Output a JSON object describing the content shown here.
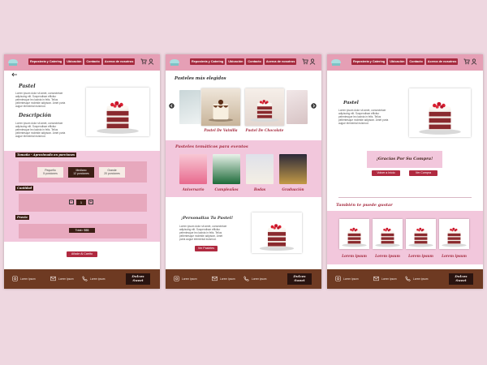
{
  "nav": {
    "links": [
      "Repostería y Catering",
      "Ubicación",
      "Contacto",
      "Acerca de nosotros"
    ]
  },
  "footer": {
    "items": [
      "Lorem Ipsum",
      "Lorem Ipsum",
      "Lorem ipsum"
    ],
    "badge_line1": "Dulces",
    "badge_line2": "Sweet"
  },
  "lorem": "Lorem ipsum dolor sit amet, consectetuer adipiscing elit. Suspendisse efficitur pelentesque leo lacinia in felis. Tellus pellentesque molestie adipiscin. Amet porta augue elemental euismod.",
  "screen1": {
    "product_title": "Pastel",
    "description_title": "Descripción",
    "size_header": "Tamaño - Aproximado en porciones",
    "sizes": [
      {
        "name": "Pequeño",
        "portions": "5 porciones"
      },
      {
        "name": "Mediano",
        "portions": "12 porciones"
      },
      {
        "name": "Grande",
        "portions": "20 porciones"
      }
    ],
    "quantity_label": "Cantidad",
    "quantity_value": "1",
    "quantity_minus": "−",
    "quantity_plus": "+",
    "price_label": "Precio",
    "total": "Total= $$$",
    "add_to_cart": "Añade Al Carrito"
  },
  "screen2": {
    "favorites_title": "Pasteles más elegidos",
    "favorites": [
      "Pastel De Vainilla",
      "Pastel De Chocolate"
    ],
    "themes_title": "Pasteles temáticos para eventos",
    "themes": [
      "Aniversario",
      "Cumpleaños",
      "Bodas",
      "Graduación"
    ],
    "personalize_title": "¡Personaliza Tu Pastel!",
    "see_cakes": "Ver Pasteles"
  },
  "screen3": {
    "product_title": "Pastel",
    "thanks": "¡Gracias Por Su Compra!",
    "back_home": "Volver a Inicio",
    "buy_again": "Ver Compra",
    "also_like": "También te puede gustar",
    "recommendations": [
      "Lorem ipsum",
      "Lorem ipsum",
      "Lorem ipsum",
      "Lorem ipsum"
    ]
  },
  "colors": {
    "background": "#eed7e0",
    "nav": "#e59fb5",
    "accent": "#a52a3e",
    "footer": "#6e3a22",
    "pink_band": "#f2c7dc"
  }
}
